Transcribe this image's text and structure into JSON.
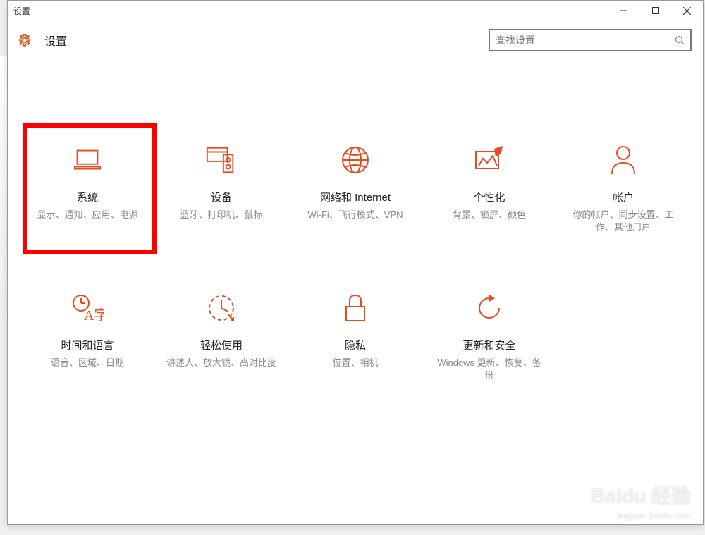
{
  "window": {
    "title": "设置"
  },
  "header": {
    "title": "设置",
    "search_placeholder": "查找设置"
  },
  "categories": [
    {
      "id": "system",
      "title": "系统",
      "desc": "显示、通知、应用、电源",
      "highlighted": true
    },
    {
      "id": "devices",
      "title": "设备",
      "desc": "蓝牙、打印机、鼠标"
    },
    {
      "id": "network",
      "title": "网络和 Internet",
      "desc": "Wi-Fi、飞行模式、VPN"
    },
    {
      "id": "personalization",
      "title": "个性化",
      "desc": "背景、锁屏、颜色"
    },
    {
      "id": "accounts",
      "title": "帐户",
      "desc": "你的帐户、同步设置、工作、其他用户"
    },
    {
      "id": "time-language",
      "title": "时间和语言",
      "desc": "语音、区域、日期"
    },
    {
      "id": "ease-of-access",
      "title": "轻松使用",
      "desc": "讲述人、放大镜、高对比度"
    },
    {
      "id": "privacy",
      "title": "隐私",
      "desc": "位置、相机"
    },
    {
      "id": "update-security",
      "title": "更新和安全",
      "desc": "Windows 更新、恢复、备份"
    }
  ],
  "watermark": {
    "main": "Baidu 经验",
    "sub": "jingyan.baidu.com"
  },
  "accent_color": "#e54d1f"
}
